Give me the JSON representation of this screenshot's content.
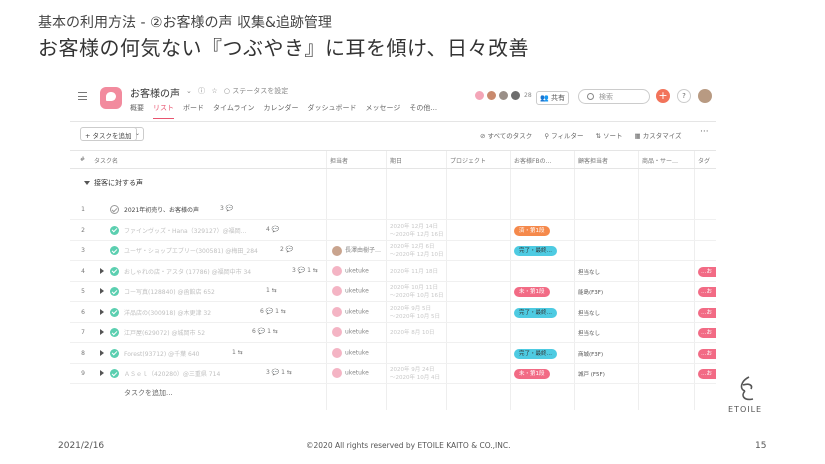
{
  "slide": {
    "subtitle": "基本の利用方法 - ②お客様の声 収集&追跡管理",
    "title": "お客様の何気ない『つぶやき』に耳を傾け、日々改善",
    "date": "2021/2/16",
    "copyright": "©2020 All rights reserved by ETOILE KAITO & CO.,INC.",
    "page": "15",
    "logo_text": "ETOILE"
  },
  "app": {
    "project_title": "お客様の声",
    "status_link": "○ ステータスを設定",
    "tabs": [
      "概要",
      "リスト",
      "ボード",
      "タイムライン",
      "カレンダー",
      "ダッシュボード",
      "メッセージ",
      "その他..."
    ],
    "active_tab": "リスト",
    "member_count": "28",
    "share_label": "共有",
    "search_placeholder": "検索",
    "plus": "+",
    "help": "?",
    "toolbar": {
      "add_task": "+ タスクを追加",
      "caret": "⌄",
      "all_tasks": "⊘ すべてのタスク",
      "filter": "⚲ フィルター",
      "sort": "⇅ ソート",
      "customize": "▦ カスタマイズ",
      "more": "···"
    },
    "columns": {
      "hash": "#",
      "task": "タスク名",
      "assignee": "担当者",
      "due": "期日",
      "project": "プロジェクト",
      "fb": "お客様FBの…",
      "cs": "顧客担当者",
      "product": "商品・サー…",
      "tag": "タグ"
    },
    "section": "接客に対する声",
    "add_task_row": "タスクを追加...",
    "colors": {
      "accent": "#e8546f",
      "done": "#5bcfb0"
    }
  },
  "rows": [
    {
      "num": "1",
      "name": "2021年初売り、お客様の声",
      "cnt": "3 💬",
      "dark": true,
      "empty": true,
      "expand": false,
      "asg": "",
      "date": "",
      "pill": "",
      "pill_color": "",
      "cs": "",
      "tag": ""
    },
    {
      "num": "2",
      "name": "ファインヴッズ・Hana（329127）@福岡…",
      "cnt": "4 💬",
      "dark": false,
      "empty": false,
      "expand": false,
      "asg": "",
      "date": "2020年 12月 14日\n～2020年 12月 16日",
      "pill": "済・第1段",
      "pill_color": "orange",
      "cs": "",
      "tag": ""
    },
    {
      "num": "3",
      "name": "ユーザ・ショップエブリー(300581) @梅田_284",
      "cnt": "2 💬",
      "dark": false,
      "empty": false,
      "expand": false,
      "asg": "長澤由樹子…",
      "asg_photo": true,
      "date": "2020年 12月 6日\n～2020年 12月 10日",
      "pill": "完了・最終…",
      "pill_color": "cyan",
      "cs": "",
      "tag": ""
    },
    {
      "num": "4",
      "name": "おしゃれの店・アスタ (17786) @福岡中市 34",
      "cnt": "3 💬 1 ⇆",
      "dark": false,
      "empty": false,
      "expand": true,
      "asg": "uketuke",
      "date": "2020年 11月 18日",
      "pill": "",
      "pill_color": "",
      "cs": "担当なし",
      "tag": "…お"
    },
    {
      "num": "5",
      "name": "コー写真(128840) @函館店 652",
      "cnt": "1 ⇆",
      "dark": false,
      "empty": false,
      "expand": true,
      "asg": "uketuke",
      "date": "2020年 10月 11日\n～2020年 10月 16日",
      "pill": "未・第1段",
      "pill_color": "pink",
      "cs": "能島(F3F)",
      "tag": "…お"
    },
    {
      "num": "6",
      "name": "洋品店の(300918) @木更津 32",
      "cnt": "6 💬 1 ⇆",
      "dark": false,
      "empty": false,
      "expand": true,
      "asg": "uketuke",
      "date": "2020年 9月 5日\n～2020年 10月 5日",
      "pill": "完了・最終…",
      "pill_color": "cyan",
      "cs": "担当なし",
      "tag": "…お"
    },
    {
      "num": "7",
      "name": "江戸屋(629072) @城岡市 52",
      "cnt": "6 💬 1 ⇆",
      "dark": false,
      "empty": false,
      "expand": true,
      "asg": "uketuke",
      "date": "2020年 8月 10日",
      "pill": "",
      "pill_color": "",
      "cs": "担当なし",
      "tag": "…お"
    },
    {
      "num": "8",
      "name": "Forest(93712) @千葉 640",
      "cnt": "1 ⇆",
      "dark": false,
      "empty": false,
      "expand": true,
      "asg": "uketuke",
      "date": "",
      "pill": "完了・最終…",
      "pill_color": "cyan",
      "cs": "商城(F3F)",
      "tag": "…お"
    },
    {
      "num": "9",
      "name": "ＡＳｅｌ（420280）@三重県 714",
      "cnt": "3 💬 1 ⇆",
      "dark": false,
      "empty": false,
      "expand": true,
      "asg": "uketuke",
      "date": "2020年 9月 24日\n～2020年 10月 4日",
      "pill": "未・第1段",
      "pill_color": "pink",
      "cs": "城戸 (F5F)",
      "tag": "…お"
    }
  ]
}
